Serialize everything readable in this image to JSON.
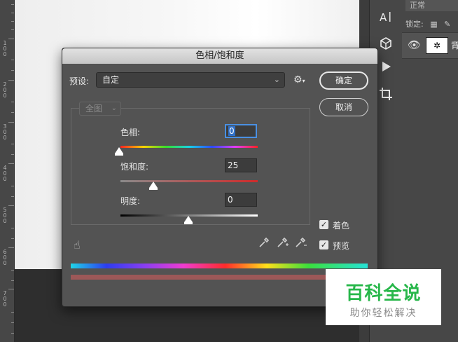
{
  "ruler": {
    "labels": [
      "1",
      "0",
      "0",
      "2",
      "0",
      "0",
      "3",
      "0",
      "0",
      "4",
      "0",
      "0",
      "5",
      "0",
      "0",
      "6",
      "0",
      "0",
      "7",
      "0",
      "0"
    ]
  },
  "layers_panel": {
    "blend_mode": "正常",
    "lock_label": "锁定:",
    "layer_name": "背"
  },
  "dialog": {
    "title": "色相/饱和度",
    "preset_label": "预设:",
    "preset_value": "自定",
    "range_value": "全图",
    "ok_label": "确定",
    "cancel_label": "取消",
    "hue_label": "色相:",
    "hue_value": "0",
    "saturation_label": "饱和度:",
    "saturation_value": "25",
    "lightness_label": "明度:",
    "lightness_value": "0",
    "colorize_label": "着色",
    "colorize_checked": true,
    "preview_label": "预览",
    "preview_checked": true
  },
  "watermark": {
    "title": "百科全说",
    "subtitle": "助你轻松解决"
  }
}
